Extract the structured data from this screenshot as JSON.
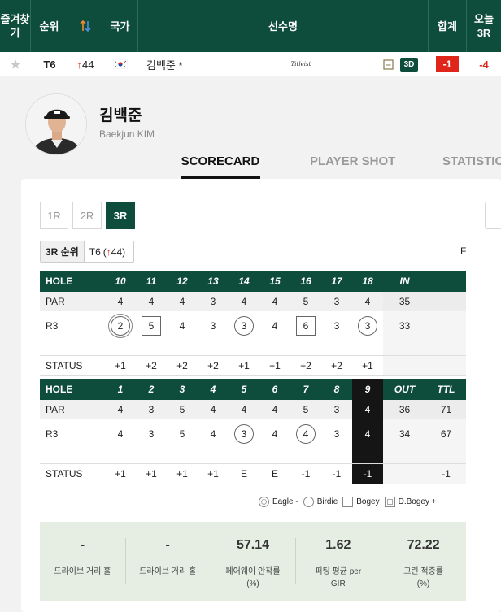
{
  "header": {
    "favorite": "즐겨찾기",
    "rank": "순위",
    "country": "국가",
    "player": "선수명",
    "total": "합계",
    "today": "오늘 3R"
  },
  "row": {
    "rank": "T6",
    "move": "44",
    "name": "김백준 *",
    "sponsor": "Titleist",
    "badge_3d": "3D",
    "total": "-1",
    "today": "-4"
  },
  "player": {
    "name_ko": "김백준",
    "name_en": "Baekjun KIM"
  },
  "tabs": [
    "SCORECARD",
    "PLAYER SHOT",
    "STATISTICS"
  ],
  "rounds": [
    "1R",
    "2R",
    "3R"
  ],
  "round_rank": {
    "label": "3R 순위",
    "rank": "T6",
    "move": "44"
  },
  "side_marker": "F",
  "in_nine": {
    "label_hole": "HOLE",
    "label_par": "PAR",
    "label_round": "R3",
    "label_status": "STATUS",
    "holes": [
      "10",
      "11",
      "12",
      "13",
      "14",
      "15",
      "16",
      "17",
      "18"
    ],
    "total_label": "IN",
    "par": [
      "4",
      "4",
      "4",
      "3",
      "4",
      "4",
      "5",
      "3",
      "4"
    ],
    "par_total": "35",
    "score": [
      "2",
      "5",
      "4",
      "3",
      "3",
      "4",
      "6",
      "3",
      "3"
    ],
    "score_total": "33",
    "score_marks": [
      "eagle",
      "bogey",
      "",
      "",
      "birdie",
      "",
      "bogey",
      "",
      "birdie"
    ],
    "status": [
      "+1",
      "+2",
      "+2",
      "+2",
      "+1",
      "+1",
      "+2",
      "+2",
      "+1"
    ]
  },
  "out_nine": {
    "label_hole": "HOLE",
    "label_par": "PAR",
    "label_round": "R3",
    "label_status": "STATUS",
    "holes": [
      "1",
      "2",
      "3",
      "4",
      "5",
      "6",
      "7",
      "8",
      "9"
    ],
    "total_label": "OUT",
    "ttl_label": "TTL",
    "par": [
      "4",
      "3",
      "5",
      "4",
      "4",
      "4",
      "5",
      "3",
      "4"
    ],
    "par_total": "36",
    "par_ttl": "71",
    "score": [
      "4",
      "3",
      "5",
      "4",
      "3",
      "4",
      "4",
      "3",
      "4"
    ],
    "score_total": "34",
    "score_ttl": "67",
    "score_marks": [
      "",
      "",
      "",
      "",
      "birdie",
      "",
      "birdie",
      "",
      ""
    ],
    "status": [
      "+1",
      "+1",
      "+1",
      "+1",
      "E",
      "E",
      "-1",
      "-1",
      "-1"
    ],
    "status_ttl": "-1",
    "highlight_hole_index": 8
  },
  "legend": [
    "Eagle -",
    "Birdie",
    "Bogey",
    "D.Bogey +"
  ],
  "stats": [
    {
      "value": "-",
      "label": "드라이브 거리 홀"
    },
    {
      "value": "-",
      "label": "드라이브 거리 홀"
    },
    {
      "value": "57.14",
      "label": "페어웨이 안착률 (%)"
    },
    {
      "value": "1.62",
      "label": "퍼팅 평균 per GIR"
    },
    {
      "value": "72.22",
      "label": "그린 적중률 (%)"
    }
  ],
  "colors": {
    "brand_green": "#0e4d3c",
    "accent_red": "#e0251b"
  }
}
